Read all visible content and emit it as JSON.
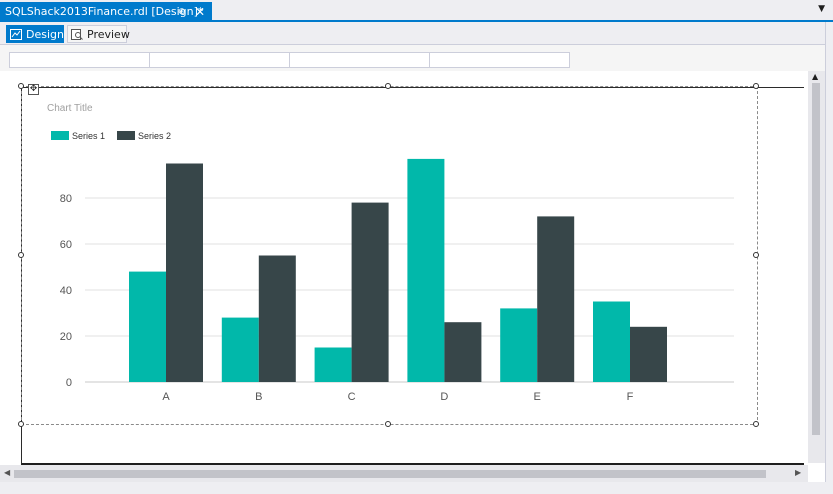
{
  "document_tab": {
    "title": "SQLShack2013Finance.rdl [Design]*",
    "pin_icon": "pin-icon",
    "close_icon": "close-icon"
  },
  "view_toolbar": {
    "design_label": "Design",
    "preview_label": "Preview",
    "active": "Design"
  },
  "colors": {
    "accent": "#007acc",
    "series1": "#01b8aa",
    "series2": "#374649"
  },
  "chart_data": {
    "type": "bar",
    "title": "Chart Title",
    "categories": [
      "A",
      "B",
      "C",
      "D",
      "E",
      "F"
    ],
    "series": [
      {
        "name": "Series 1",
        "values": [
          48,
          28,
          15,
          97,
          32,
          35
        ]
      },
      {
        "name": "Series 2",
        "values": [
          95,
          55,
          78,
          26,
          72,
          24
        ]
      }
    ],
    "yticks": [
      0,
      20,
      40,
      60,
      80
    ],
    "ylim": [
      0,
      100
    ],
    "legend_position": "top-left",
    "grid": true
  }
}
